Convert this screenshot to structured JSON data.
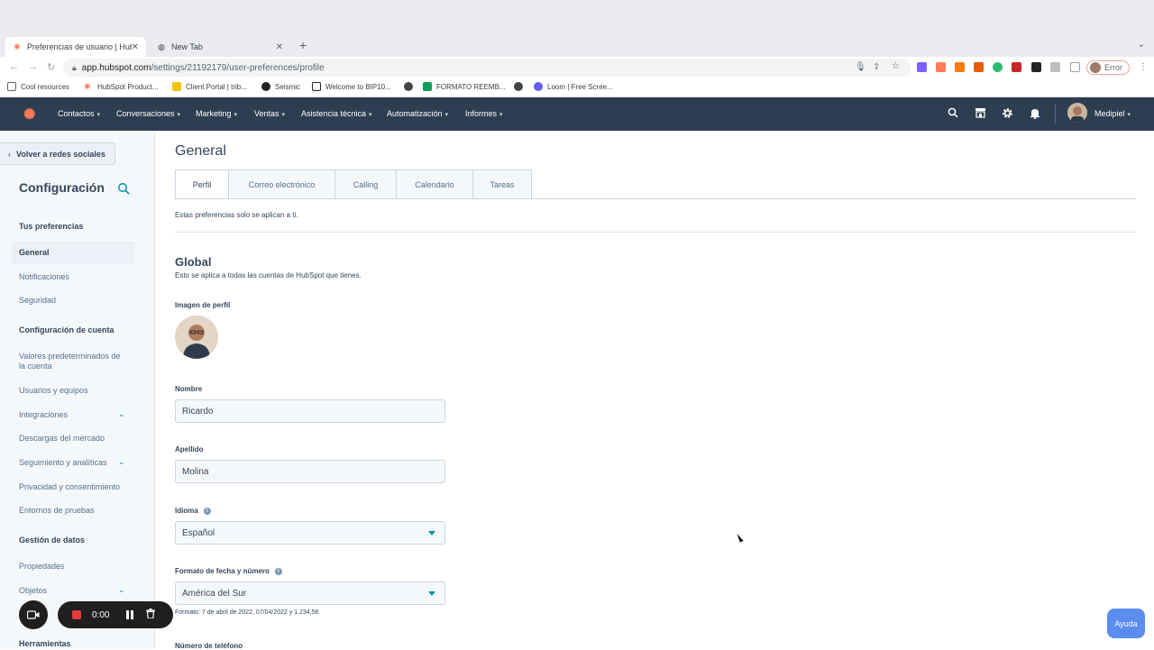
{
  "browser": {
    "tabs": [
      {
        "title": "Preferencias de usuario | HubSp",
        "active": true,
        "close": "✕"
      },
      {
        "title": "New Tab",
        "active": false,
        "close": "✕"
      }
    ],
    "new_tab": "+",
    "url_host": "app.hubspot.com",
    "url_path": "/settings/21192179/user-preferences/profile",
    "profile_status": "Error",
    "bookmarks": [
      "Cool resources",
      "HubSpot Product...",
      "Client Portal | trib...",
      "Seismic",
      "Welcome to BIP10...",
      "FORMATO REEMB...",
      "Loom | Free Scree..."
    ]
  },
  "hubspot": {
    "menu": [
      "Contactos",
      "Conversaciones",
      "Marketing",
      "Ventas",
      "Asistencia técnica",
      "Automatización",
      "Informes"
    ],
    "account": "Medipiel"
  },
  "sidebar": {
    "back": "Volver a redes sociales",
    "title": "Configuración",
    "sections": {
      "prefs": "Tus preferencias",
      "account": "Configuración de cuenta",
      "data": "Gestión de datos",
      "tools": "Herramientas"
    },
    "items": {
      "general": "General",
      "notifications": "Notificaciones",
      "security": "Seguridad",
      "defaults": "Valores predeterminados de la cuenta",
      "users": "Usuarios y equipos",
      "integrations": "Integraciones",
      "marketplace": "Descargas del mercado",
      "tracking": "Seguimiento y analíticas",
      "privacy": "Privacidad y consentimiento",
      "sandboxes": "Entornos de pruebas",
      "properties": "Propiedades",
      "objects": "Objetos"
    }
  },
  "main": {
    "title": "General",
    "tabs": [
      "Perfil",
      "Correo electrónico",
      "Calling",
      "Calendario",
      "Tareas"
    ],
    "note": "Estas preferencias solo se aplican a ti.",
    "section_title": "Global",
    "section_desc": "Esto se aplica a todas las cuentas de HubSpot que tienes.",
    "labels": {
      "profile_image": "Imagen de perfil",
      "first_name": "Nombre",
      "last_name": "Apellido",
      "language": "Idioma",
      "date_format": "Formato de fecha y número",
      "phone": "Número de teléfono"
    },
    "values": {
      "first_name": "Ricardo",
      "last_name": "Molina",
      "language": "Español",
      "date_format": "América del Sur"
    },
    "format_help": "Formato: 7 de abril de 2022, 07/04/2022 y 1.234,56"
  },
  "recorder": {
    "time": "0:00"
  },
  "help_button": "Ayuda"
}
